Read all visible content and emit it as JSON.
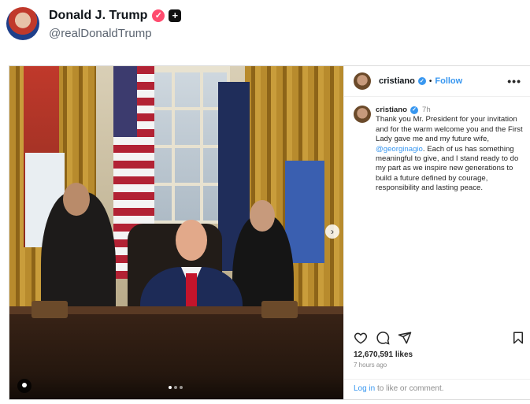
{
  "post": {
    "author_name": "Donald J. Trump",
    "author_handle": "@realDonaldTrump"
  },
  "instagram": {
    "username": "cristiano",
    "separator": "•",
    "follow_label": "Follow",
    "more_label": "•••",
    "caption_user": "cristiano",
    "caption_time": "7h",
    "caption_part1": "Thank you Mr. President for your invitation and for the warm welcome you and the First Lady gave me and my future wife, ",
    "caption_mention": "@georginagio",
    "caption_part2": ". Each of us has something meaningful to give, and I stand ready to do my part as we inspire new generations to build a future defined by courage, responsibility and lasting peace.",
    "likes": "12,670,591 likes",
    "posted_ago": "7 hours ago",
    "login_link": "Log in",
    "login_rest": " to like or comment."
  },
  "colors": {
    "link_blue": "#3897f0",
    "verified_pink": "#ff4b6e"
  },
  "icons": {
    "author_badge": "verified-icon",
    "plus": "plus-icon",
    "heart": "heart-icon",
    "comment": "comment-icon",
    "share": "share-icon",
    "save": "save-icon",
    "carousel": "chevron-right-icon",
    "tag": "user-tag-icon"
  },
  "carousel": {
    "slide_count": 3,
    "active_index": 1
  }
}
